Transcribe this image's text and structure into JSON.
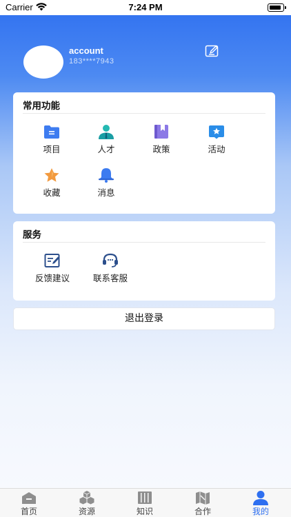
{
  "status_bar": {
    "carrier": "Carrier",
    "time": "7:24 PM"
  },
  "profile": {
    "username": "account",
    "phone": "183****7943"
  },
  "common_functions": {
    "title": "常用功能",
    "items": [
      {
        "label": "项目",
        "icon": "folder-icon"
      },
      {
        "label": "人才",
        "icon": "person-icon"
      },
      {
        "label": "政策",
        "icon": "book-icon"
      },
      {
        "label": "活动",
        "icon": "star-badge-icon"
      },
      {
        "label": "收藏",
        "icon": "star-icon"
      },
      {
        "label": "消息",
        "icon": "bell-icon"
      }
    ]
  },
  "services": {
    "title": "服务",
    "items": [
      {
        "label": "反馈建议",
        "icon": "feedback-icon"
      },
      {
        "label": "联系客服",
        "icon": "headset-icon"
      }
    ]
  },
  "logout_label": "退出登录",
  "tabbar": {
    "items": [
      {
        "label": "首页",
        "icon": "home-icon"
      },
      {
        "label": "资源",
        "icon": "boxes-icon"
      },
      {
        "label": "知识",
        "icon": "books-icon"
      },
      {
        "label": "合作",
        "icon": "map-icon"
      },
      {
        "label": "我的",
        "icon": "user-icon",
        "active": true
      }
    ]
  },
  "colors": {
    "primary": "#2e6ff0",
    "card_bg": "#ffffff",
    "tab_active": "#2e6ff0"
  }
}
